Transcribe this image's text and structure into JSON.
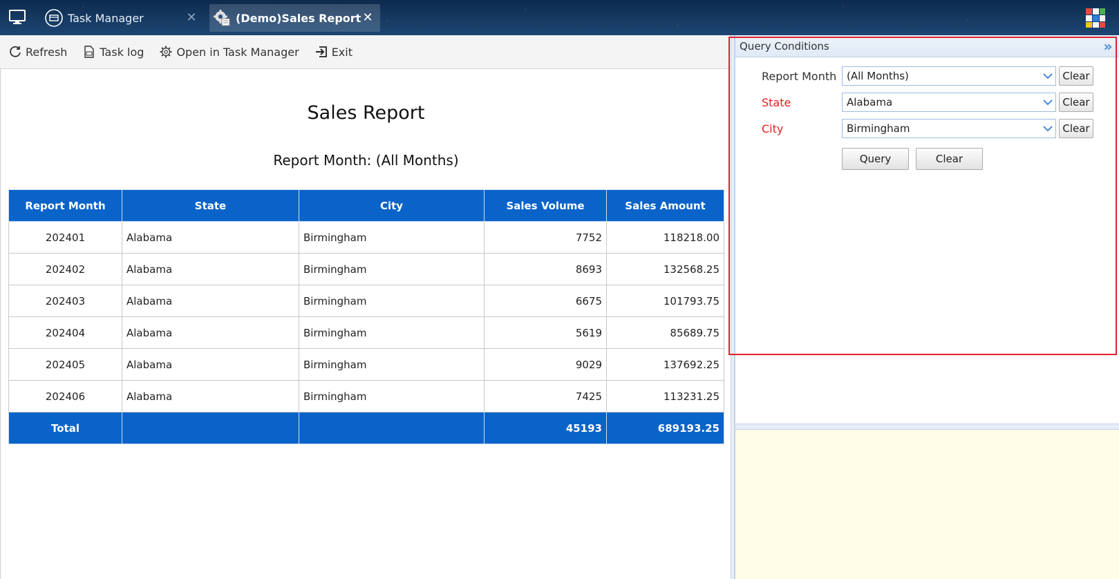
{
  "tabs": [
    {
      "label": "Task Manager",
      "icon": "task-manager-icon",
      "active": false
    },
    {
      "label": "(Demo)Sales Report...",
      "icon": "report-gear-icon",
      "active": true
    }
  ],
  "toolbar": {
    "refresh_label": "Refresh",
    "task_log_label": "Task log",
    "open_in_task_manager_label": "Open in Task Manager",
    "exit_label": "Exit"
  },
  "report": {
    "title": "Sales Report",
    "subtitle": "Report Month: (All Months)",
    "columns": [
      "Report Month",
      "State",
      "City",
      "Sales Volume",
      "Sales Amount"
    ],
    "rows": [
      {
        "month": "202401",
        "state": "Alabama",
        "city": "Birmingham",
        "volume": "7752",
        "amount": "118218.00"
      },
      {
        "month": "202402",
        "state": "Alabama",
        "city": "Birmingham",
        "volume": "8693",
        "amount": "132568.25"
      },
      {
        "month": "202403",
        "state": "Alabama",
        "city": "Birmingham",
        "volume": "6675",
        "amount": "101793.75"
      },
      {
        "month": "202404",
        "state": "Alabama",
        "city": "Birmingham",
        "volume": "5619",
        "amount": "85689.75"
      },
      {
        "month": "202405",
        "state": "Alabama",
        "city": "Birmingham",
        "volume": "9029",
        "amount": "137692.25"
      },
      {
        "month": "202406",
        "state": "Alabama",
        "city": "Birmingham",
        "volume": "7425",
        "amount": "113231.25"
      }
    ],
    "total": {
      "label": "Total",
      "state": "",
      "city": "",
      "volume": "45193",
      "amount": "689193.25"
    }
  },
  "query_panel": {
    "title": "Query Conditions",
    "fields": [
      {
        "label": "Report Month",
        "value": "(All Months)",
        "required": false,
        "clear_label": "Clear"
      },
      {
        "label": "State",
        "value": "Alabama",
        "required": true,
        "clear_label": "Clear"
      },
      {
        "label": "City",
        "value": "Birmingham",
        "required": true,
        "clear_label": "Clear"
      }
    ],
    "query_button": "Query",
    "clear_button": "Clear"
  },
  "colors": {
    "header_blue": "#0a63c9",
    "required_red": "#e02020",
    "highlight_red": "#e02030",
    "lower_panel_bg": "#fffde8"
  }
}
